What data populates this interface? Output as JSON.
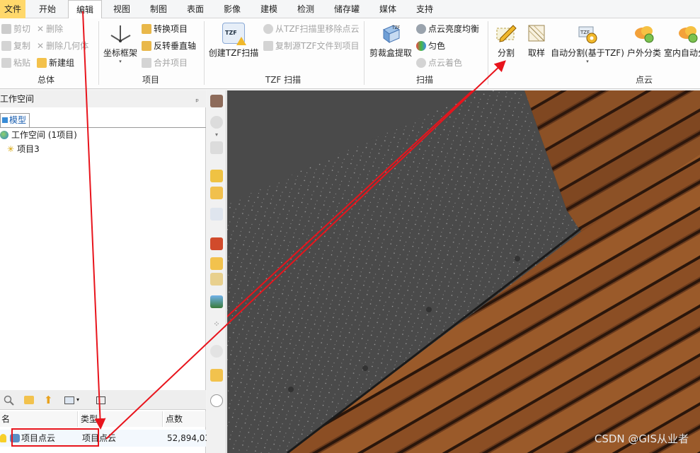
{
  "menu": {
    "tabs": [
      "文件",
      "开始",
      "编辑",
      "视图",
      "制图",
      "表面",
      "影像",
      "建模",
      "检测",
      "储存罐",
      "媒体",
      "支持"
    ],
    "active_tab": "编辑"
  },
  "ribbon": {
    "general": {
      "label": "总体",
      "cut": "剪切",
      "delete": "删除",
      "copy": "复制",
      "delete_geometry": "删除几何体",
      "paste": "粘贴",
      "new_group": "新建组"
    },
    "project": {
      "label": "项目",
      "coord_frame": "坐标框架",
      "convert_item": "转换项目",
      "flip_vertical": "反转垂直轴",
      "merge_items": "合并项目"
    },
    "tzf": {
      "label": "TZF 扫描",
      "create_tzf": "创建TZF扫描",
      "remove_cloud": "从TZF扫描里移除点云",
      "copy_source": "复制源TZF文件到项目"
    },
    "scan": {
      "label": "扫描",
      "clip_box": "剪裁盒提取",
      "brightness": "点云亮度均衡",
      "uniform_color": "匀色",
      "cloud_color": "点云着色"
    },
    "pointcloud": {
      "label": "点云",
      "segment": "分割",
      "sample": "取样",
      "auto_segment": "自动分割(基于TZF)",
      "outdoor": "户外分类",
      "indoor": "室内自动分"
    }
  },
  "workspace": {
    "title": "工作空间",
    "model_tab": "模型",
    "root": "工作空间 (1项目)",
    "project": "项目3"
  },
  "list": {
    "columns": [
      "名",
      "类型",
      "点数"
    ],
    "row": {
      "name": "项目点云",
      "type": "项目点云",
      "points": "52,894,03"
    }
  },
  "watermark": "CSDN @GIS从业者",
  "colors": {
    "accent": "#ffd86b",
    "arrow": "#e8141c",
    "highlight_box": "#e8141c"
  }
}
